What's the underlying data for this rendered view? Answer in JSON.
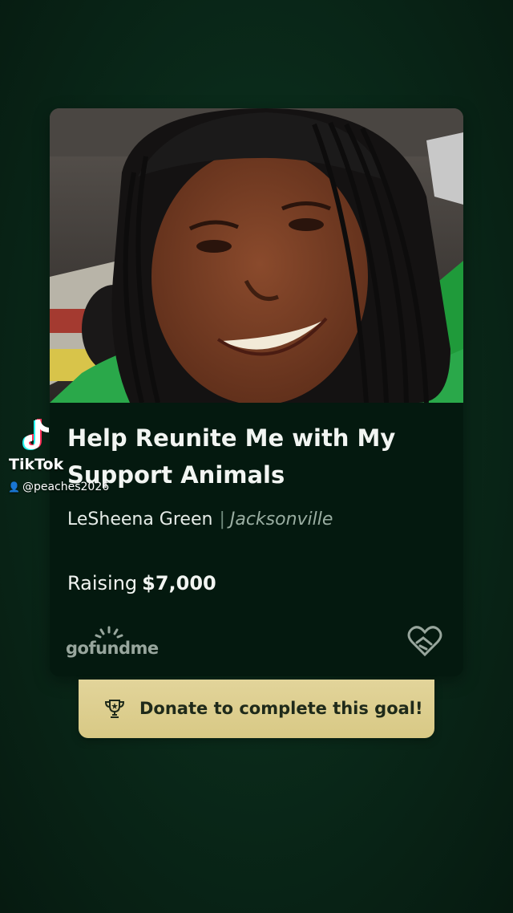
{
  "campaign": {
    "title": "Help Reunite Me with My Support Animals",
    "organizer": "LeSheena Green",
    "location": "Jacksonville",
    "raising_label": "Raising",
    "goal_amount": "$7,000"
  },
  "brand": {
    "logo_text": "gofundme",
    "logo_icon": "gofundme-sunrise-icon",
    "heart_icon": "hand-heart-icon"
  },
  "donate": {
    "label": "Donate to complete this goal!",
    "icon": "trophy-icon"
  },
  "watermark": {
    "brand": "TikTok",
    "handle": "@peaches2026",
    "icon": "tiktok-note-icon"
  },
  "colors": {
    "background": "#0a2a1a",
    "card": "#04190f",
    "donate_button": "#dccd8c",
    "text": "#f2f5f2"
  }
}
